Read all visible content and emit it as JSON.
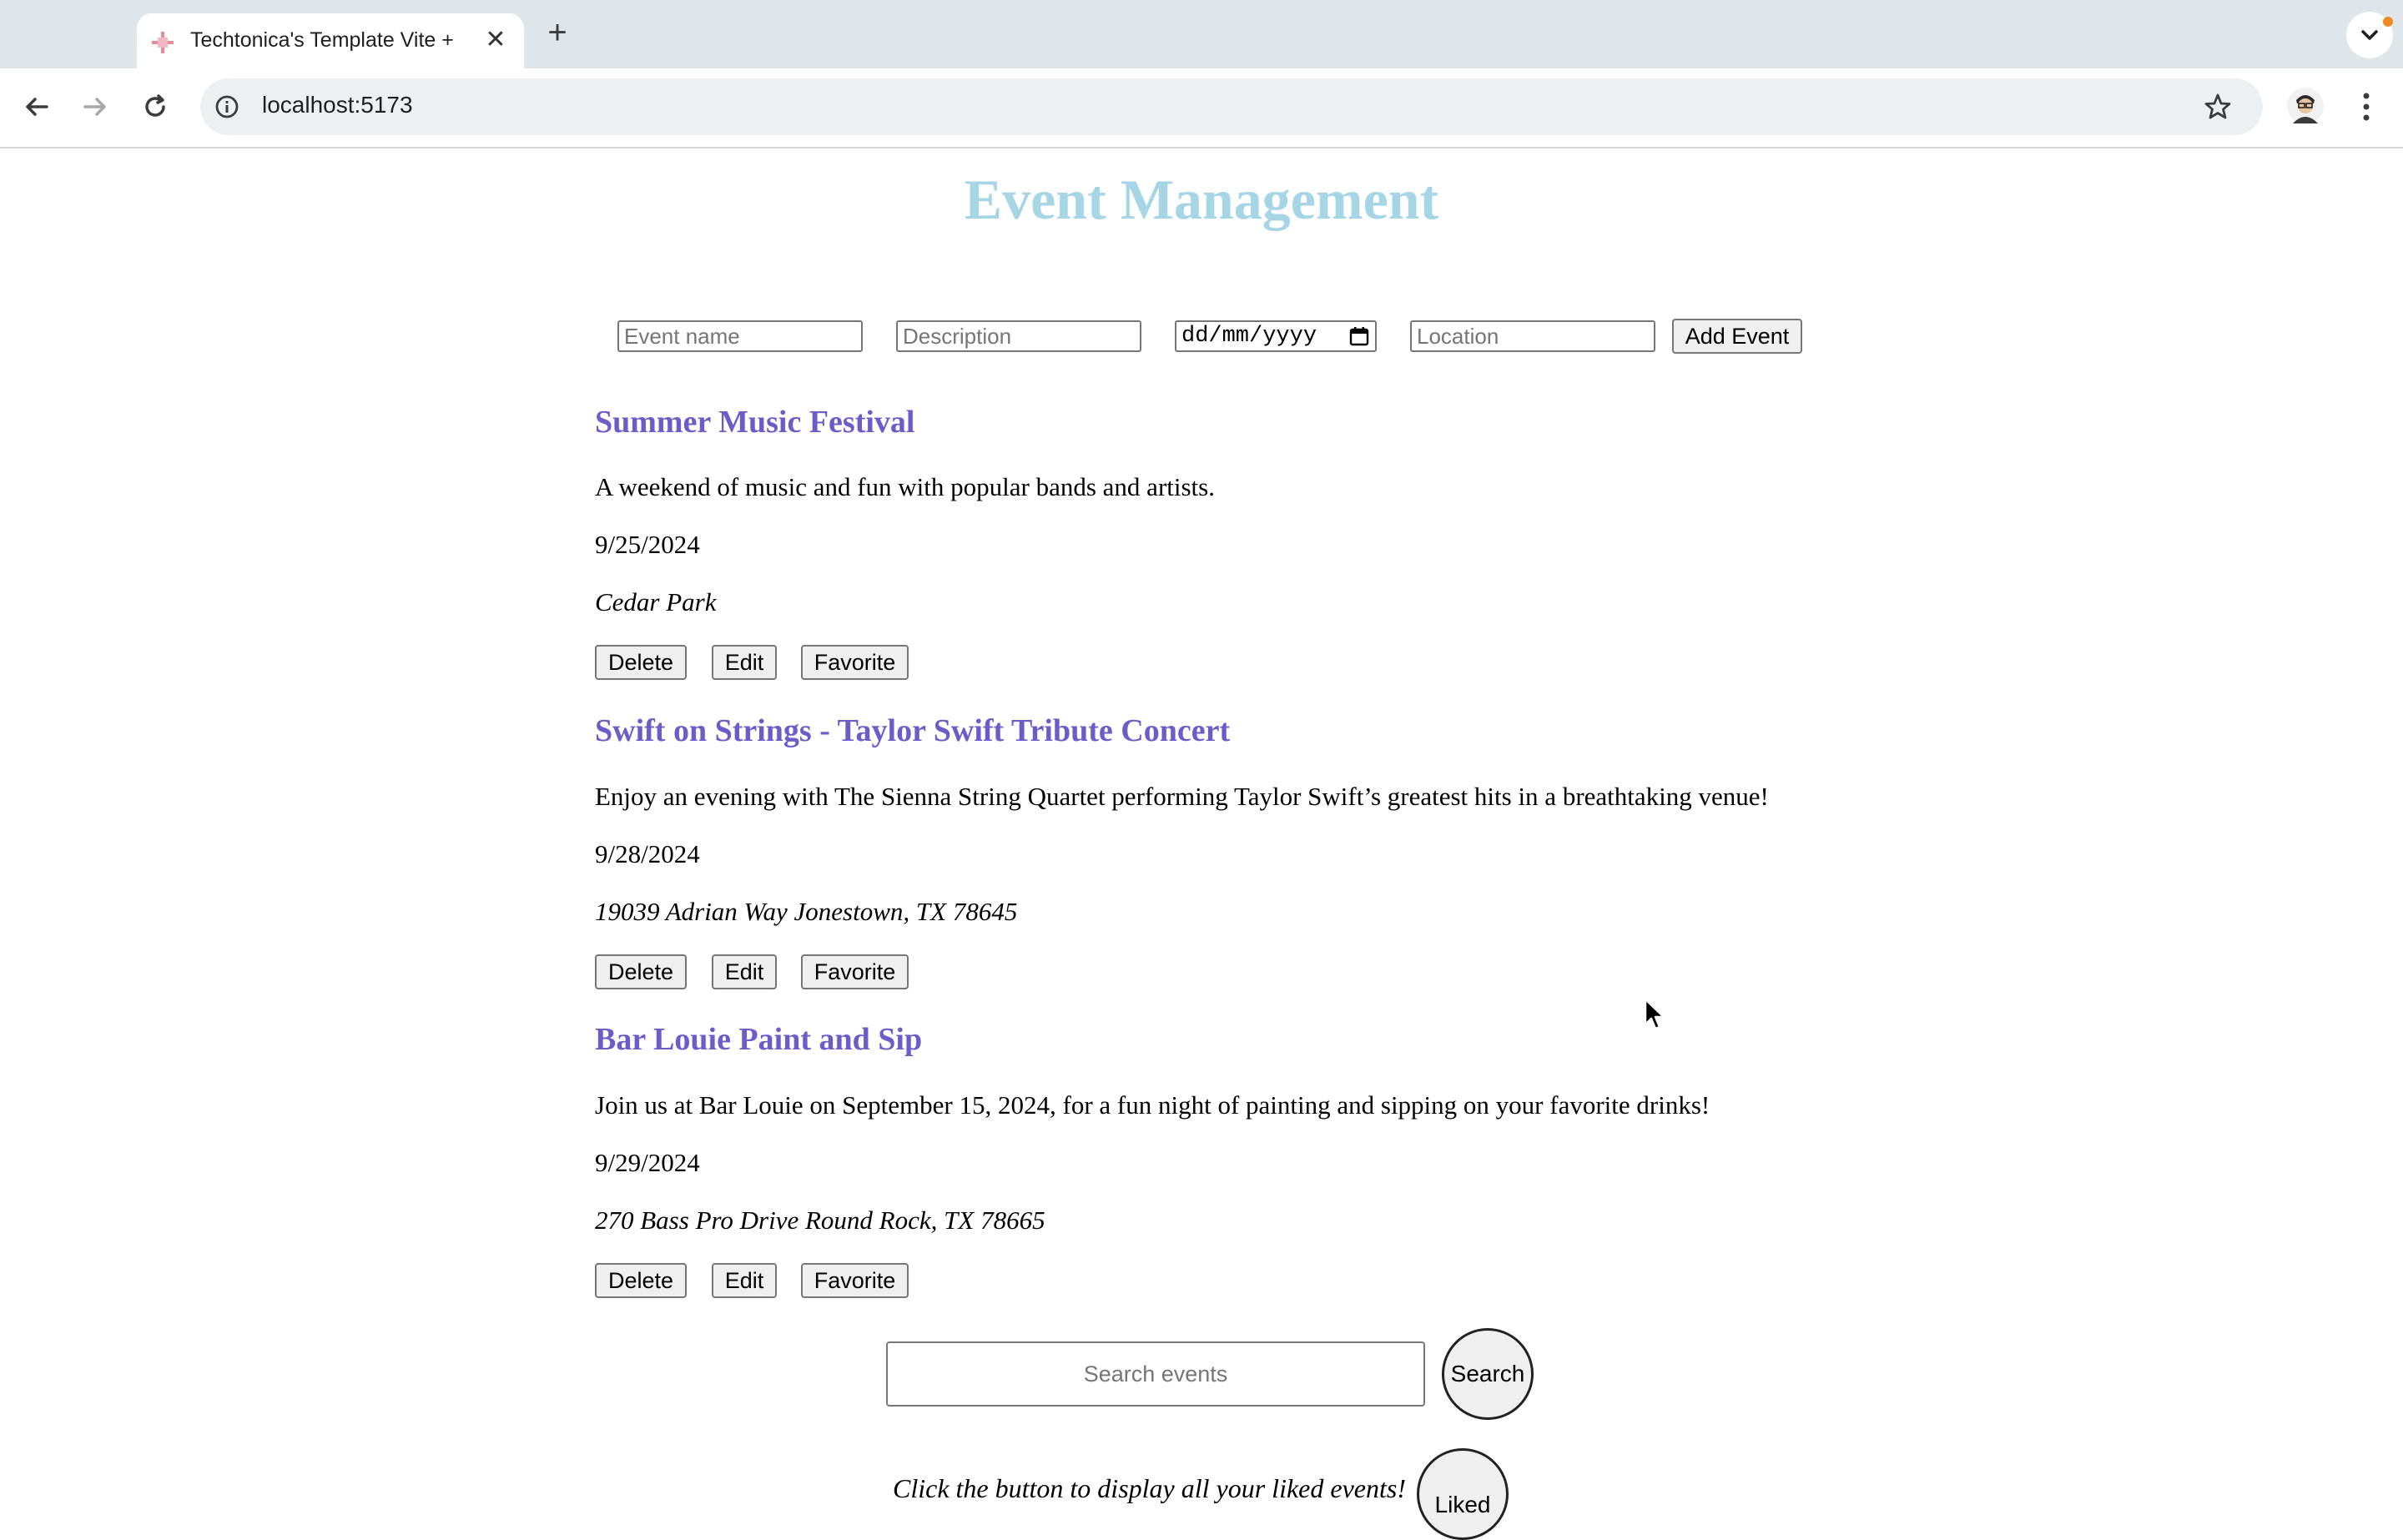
{
  "browser": {
    "tab_title": "Techtonica's Template Vite + ",
    "tab_close": "✕",
    "new_tab": "+",
    "url": "localhost:5173",
    "icons": [
      "favicon-icon",
      "close-icon",
      "plus-icon",
      "chevron-down-icon",
      "back-icon",
      "forward-icon",
      "reload-icon",
      "info-icon",
      "star-icon",
      "avatar",
      "kebab-menu-icon"
    ]
  },
  "page": {
    "title": "Event Management"
  },
  "form": {
    "name_placeholder": "Event name",
    "description_placeholder": "Description",
    "date_value": "dd/mm/yyyy",
    "location_placeholder": "Location",
    "add_label": "Add Event"
  },
  "events": [
    {
      "title": "Summer Music Festival",
      "description": "A weekend of music and fun with popular bands and artists.",
      "date": "9/25/2024",
      "location": "Cedar Park",
      "delete_label": "Delete",
      "edit_label": "Edit",
      "favorite_label": "Favorite"
    },
    {
      "title": "Swift on Strings - Taylor Swift Tribute Concert",
      "description": "Enjoy an evening with The Sienna String Quartet performing Taylor Swift’s greatest hits in a breathtaking venue!",
      "date": "9/28/2024",
      "location": "19039 Adrian Way Jonestown, TX 78645",
      "delete_label": "Delete",
      "edit_label": "Edit",
      "favorite_label": "Favorite"
    },
    {
      "title": "Bar Louie Paint and Sip",
      "description": "Join us at Bar Louie on September 15, 2024, for a fun night of painting and sipping on your favorite drinks!",
      "date": "9/29/2024",
      "location": "270 Bass Pro Drive Round Rock, TX 78665",
      "delete_label": "Delete",
      "edit_label": "Edit",
      "favorite_label": "Favorite"
    }
  ],
  "search": {
    "placeholder": "Search events",
    "button_label": "Search"
  },
  "liked": {
    "caption": "Click the button to display all your liked events!",
    "button_label": "Liked"
  },
  "colors": {
    "title": "#a6d6e6",
    "event_title": "#6b5dc9",
    "tab_strip": "#dfe5e8",
    "notification_dot": "#f08a24"
  }
}
